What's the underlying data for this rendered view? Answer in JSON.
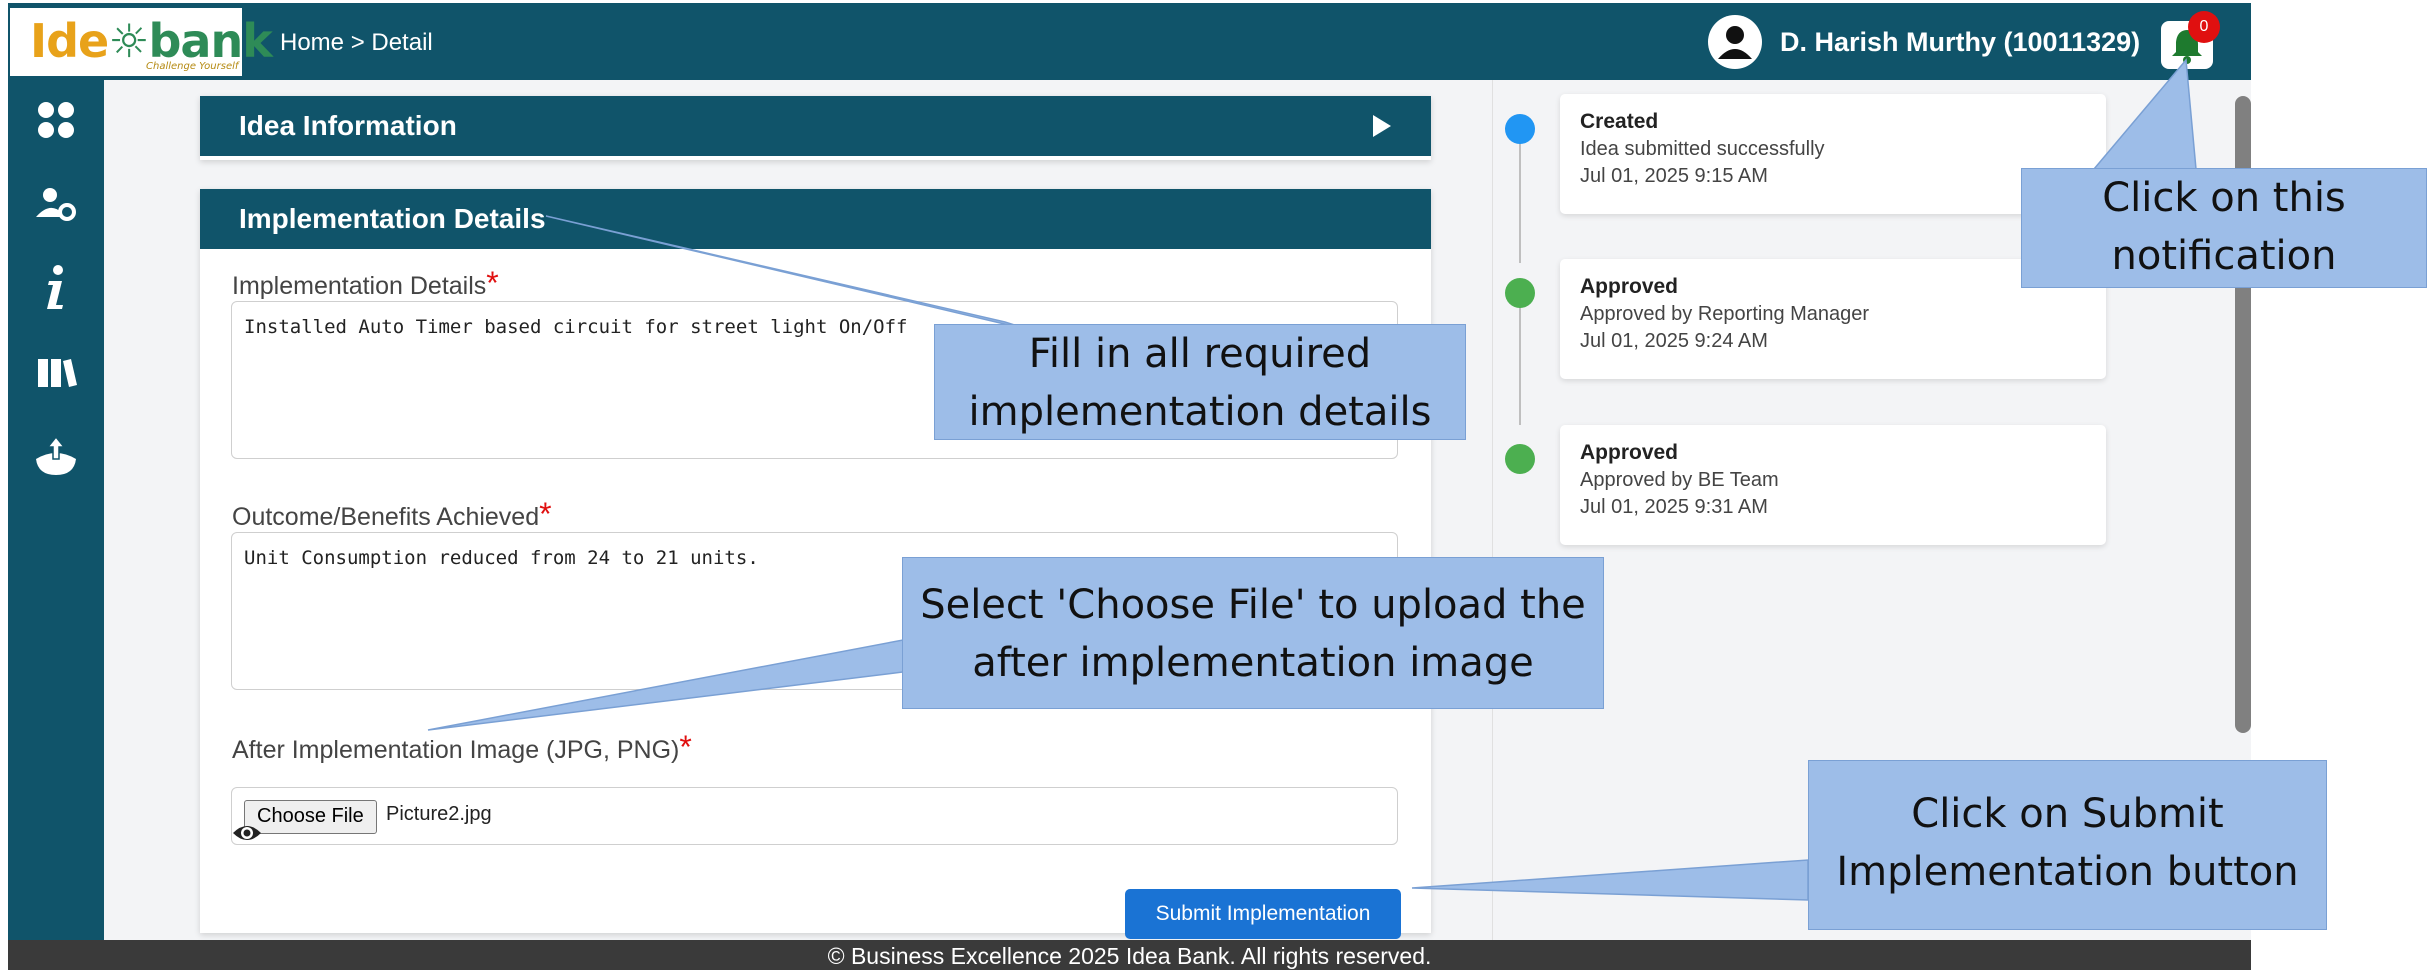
{
  "header": {
    "logo_text_a": "Ide",
    "logo_text_b": "bank",
    "logo_tagline": "Challenge Yourself",
    "breadcrumb": "Home > Detail",
    "user_name": "D. Harish Murthy (10011329)",
    "notification_count": "0"
  },
  "sidebar": {
    "icons": [
      "dashboard-grid-icon",
      "user-settings-icon",
      "info-icon",
      "library-icon",
      "upload-icon"
    ]
  },
  "idea_info": {
    "title": "Idea Information"
  },
  "implementation": {
    "title": "Implementation Details",
    "details_label": "Implementation Details",
    "details_value": "Installed Auto Timer based circuit for street light On/Off",
    "outcome_label": "Outcome/Benefits Achieved",
    "outcome_value": "Unit Consumption reduced from 24 to 21 units.",
    "image_label": "After Implementation Image (JPG, PNG)",
    "choose_file_label": "Choose File",
    "file_name": "Picture2.jpg",
    "required_mark": "*",
    "submit_label": "Submit Implementation"
  },
  "timeline": [
    {
      "status": "Created",
      "desc": "Idea submitted successfully",
      "date": "Jul 01, 2025 9:15 AM",
      "color": "#2196f3"
    },
    {
      "status": "Approved",
      "desc": "Approved by Reporting Manager",
      "date": "Jul 01, 2025 9:24 AM",
      "color": "#4caf50"
    },
    {
      "status": "Approved",
      "desc": "Approved by BE Team",
      "date": "Jul 01, 2025 9:31 AM",
      "color": "#4caf50"
    }
  ],
  "footer": {
    "text": "© Business Excellence 2025 Idea Bank. All rights reserved."
  },
  "callouts": {
    "fill_line1": "Fill in all required",
    "fill_line2": "implementation details",
    "choose_line1": "Select 'Choose File' to upload the",
    "choose_line2": "after implementation image",
    "notif_line1": "Click on this",
    "notif_line2": "notification",
    "submit_line1": "Click on Submit",
    "submit_line2": "Implementation button"
  },
  "colors": {
    "primary": "#10546a",
    "button": "#1a73d4",
    "required": "#e01010",
    "callout": "#9dbde8"
  }
}
